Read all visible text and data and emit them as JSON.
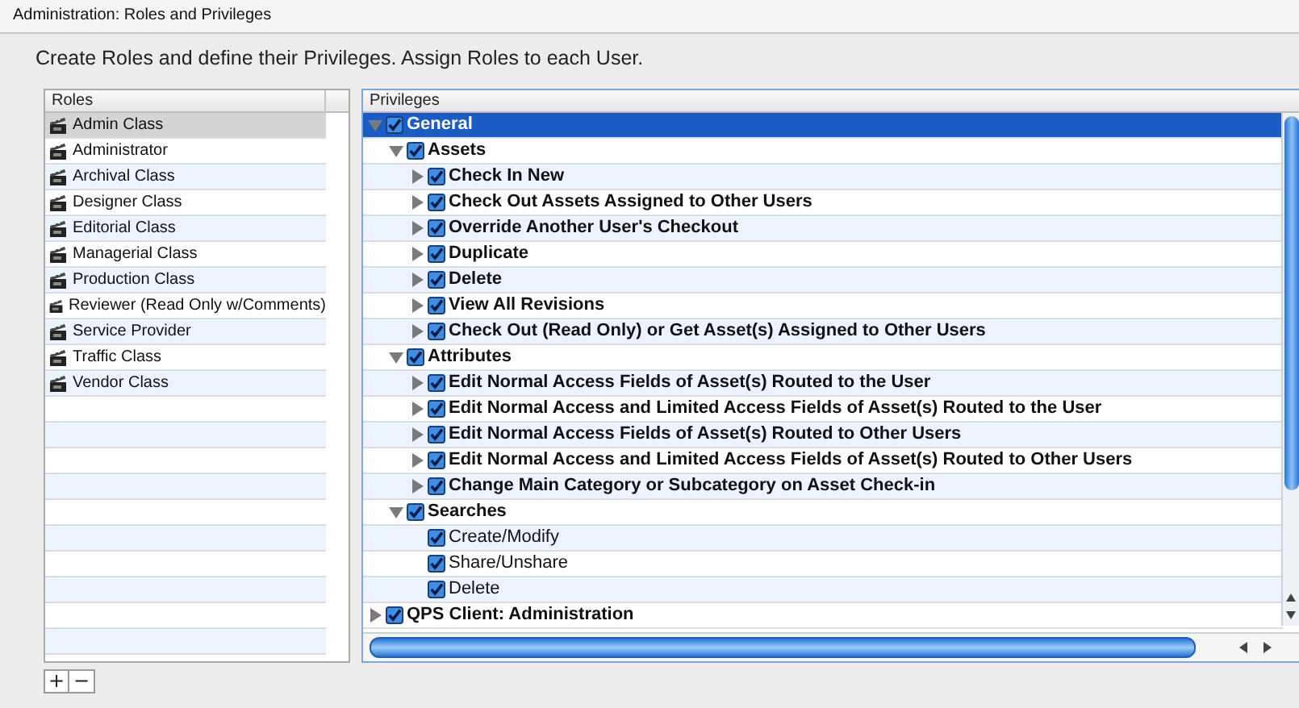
{
  "window": {
    "title": "Administration: Roles and Privileges"
  },
  "instruction": "Create Roles and define their Privileges. Assign Roles to each User.",
  "roles": {
    "column": "Roles",
    "items": [
      {
        "label": "Admin Class",
        "selected": true
      },
      {
        "label": "Administrator",
        "selected": false
      },
      {
        "label": "Archival Class",
        "selected": false
      },
      {
        "label": "Designer Class",
        "selected": false
      },
      {
        "label": "Editorial Class",
        "selected": false
      },
      {
        "label": "Managerial Class",
        "selected": false
      },
      {
        "label": "Production Class",
        "selected": false
      },
      {
        "label": "Reviewer (Read Only w/Comments)",
        "selected": false
      },
      {
        "label": "Service Provider",
        "selected": false
      },
      {
        "label": "Traffic Class",
        "selected": false
      },
      {
        "label": "Vendor Class",
        "selected": false
      }
    ]
  },
  "privileges": {
    "column": "Privileges",
    "items": [
      {
        "label": "General",
        "checked": true,
        "expanded": true,
        "selected": true,
        "children": [
          {
            "label": "Assets",
            "checked": true,
            "expanded": true,
            "selected": false,
            "children": [
              {
                "label": "Check In New",
                "checked": true,
                "expanded": false,
                "selected": false
              },
              {
                "label": "Check Out Assets Assigned to Other Users",
                "checked": true,
                "expanded": false,
                "selected": false
              },
              {
                "label": "Override Another User's Checkout",
                "checked": true,
                "expanded": false,
                "selected": false
              },
              {
                "label": "Duplicate",
                "checked": true,
                "expanded": false,
                "selected": false
              },
              {
                "label": "Delete",
                "checked": true,
                "expanded": false,
                "selected": false
              },
              {
                "label": "View All Revisions",
                "checked": true,
                "expanded": false,
                "selected": false
              },
              {
                "label": "Check Out (Read Only) or Get Asset(s) Assigned to Other Users",
                "checked": true,
                "expanded": false,
                "selected": false
              }
            ]
          },
          {
            "label": "Attributes",
            "checked": true,
            "expanded": true,
            "selected": false,
            "children": [
              {
                "label": "Edit Normal Access Fields of Asset(s) Routed to the User",
                "checked": true,
                "expanded": false,
                "selected": false
              },
              {
                "label": "Edit Normal Access and Limited Access Fields of Asset(s) Routed to the User",
                "checked": true,
                "expanded": false,
                "selected": false
              },
              {
                "label": "Edit Normal Access Fields of Asset(s) Routed to Other Users",
                "checked": true,
                "expanded": false,
                "selected": false
              },
              {
                "label": "Edit Normal Access and Limited Access Fields of Asset(s) Routed to Other Users",
                "checked": true,
                "expanded": false,
                "selected": false
              },
              {
                "label": "Change Main Category or Subcategory on Asset Check-in",
                "checked": true,
                "expanded": false,
                "selected": false
              }
            ]
          },
          {
            "label": "Searches",
            "checked": true,
            "expanded": true,
            "selected": false,
            "children": [
              {
                "label": "Create/Modify",
                "checked": true,
                "selected": false
              },
              {
                "label": "Share/Unshare",
                "checked": true,
                "selected": false
              },
              {
                "label": "Delete",
                "checked": true,
                "selected": false
              }
            ]
          }
        ]
      },
      {
        "label": "QPS Client: Administration",
        "checked": true,
        "expanded": false,
        "selected": false
      }
    ]
  },
  "buttons": [
    "+",
    "−"
  ]
}
